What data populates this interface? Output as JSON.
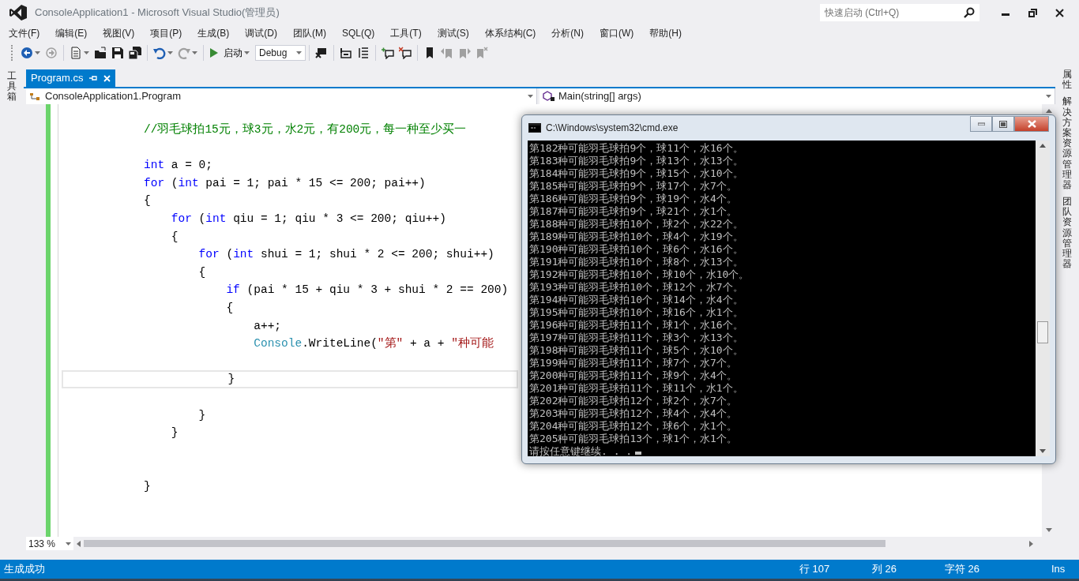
{
  "window": {
    "title": "ConsoleApplication1 - Microsoft Visual Studio(管理员)"
  },
  "quick_launch": {
    "placeholder": "快速启动 (Ctrl+Q)"
  },
  "menu": [
    {
      "label": "文件(F)"
    },
    {
      "label": "编辑(E)"
    },
    {
      "label": "视图(V)"
    },
    {
      "label": "项目(P)"
    },
    {
      "label": "生成(B)"
    },
    {
      "label": "调试(D)"
    },
    {
      "label": "团队(M)"
    },
    {
      "label": "SQL(Q)"
    },
    {
      "label": "工具(T)"
    },
    {
      "label": "测试(S)"
    },
    {
      "label": "体系结构(C)"
    },
    {
      "label": "分析(N)"
    },
    {
      "label": "窗口(W)"
    },
    {
      "label": "帮助(H)"
    }
  ],
  "toolbar": [
    {
      "kind": "back",
      "disabled": false
    },
    {
      "kind": "forward",
      "disabled": true
    },
    {
      "kind": "separator"
    },
    {
      "kind": "new",
      "disabled": false
    },
    {
      "kind": "open",
      "disabled": false
    },
    {
      "kind": "save",
      "disabled": false
    },
    {
      "kind": "save-all",
      "disabled": false
    },
    {
      "kind": "separator"
    },
    {
      "kind": "undo",
      "disabled": false
    },
    {
      "kind": "redo",
      "disabled": true
    },
    {
      "kind": "separator"
    },
    {
      "kind": "start",
      "label": "启动",
      "disabled": false
    },
    {
      "kind": "configuration",
      "value": "Debug"
    },
    {
      "kind": "separator"
    },
    {
      "kind": "attach",
      "disabled": false
    },
    {
      "kind": "separator"
    },
    {
      "kind": "outdent",
      "disabled": false
    },
    {
      "kind": "indent",
      "disabled": false
    },
    {
      "kind": "separator"
    },
    {
      "kind": "comment",
      "disabled": false
    },
    {
      "kind": "uncomment",
      "disabled": false
    },
    {
      "kind": "separator"
    },
    {
      "kind": "bookmark",
      "disabled": false
    },
    {
      "kind": "bookmark-prev",
      "disabled": true
    },
    {
      "kind": "bookmark-next",
      "disabled": true
    },
    {
      "kind": "bookmark-clear",
      "disabled": true
    }
  ],
  "left_tool_windows": [
    {
      "label": "工具箱"
    }
  ],
  "right_tool_windows": [
    {
      "label": "属性"
    },
    {
      "label": "解决方案资源管理器"
    },
    {
      "label": "团队资源管理器"
    }
  ],
  "tabs": [
    {
      "label": "Program.cs",
      "selected": true
    }
  ],
  "navigation": {
    "type": "ConsoleApplication1.Program",
    "member": "Main(string[] args)"
  },
  "code_lines": [
    {
      "kind": "code",
      "current": false,
      "tokens": [
        {
          "kind": "comment",
          "text": "//羽毛球拍15元，球3元，水2元，有200元，每一种至少买一"
        }
      ]
    },
    {
      "kind": "blank"
    },
    {
      "kind": "code",
      "current": false,
      "tokens": [
        {
          "kind": "keyword",
          "text": "int"
        },
        {
          "kind": "plain",
          "text": " a = 0;"
        }
      ]
    },
    {
      "kind": "code",
      "current": false,
      "tokens": [
        {
          "kind": "keyword",
          "text": "for"
        },
        {
          "kind": "plain",
          "text": " ("
        },
        {
          "kind": "keyword",
          "text": "int"
        },
        {
          "kind": "plain",
          "text": " pai = 1; pai * 15 <= 200; pai++)"
        }
      ]
    },
    {
      "kind": "code",
      "current": false,
      "tokens": [
        {
          "kind": "plain",
          "text": "{"
        }
      ]
    },
    {
      "kind": "code",
      "current": false,
      "tokens": [
        {
          "kind": "keyword",
          "text": "    for"
        },
        {
          "kind": "plain",
          "text": " ("
        },
        {
          "kind": "keyword",
          "text": "int"
        },
        {
          "kind": "plain",
          "text": " qiu = 1; qiu * 3 <= 200; qiu++)"
        }
      ]
    },
    {
      "kind": "code",
      "current": false,
      "tokens": [
        {
          "kind": "plain",
          "text": "    {"
        }
      ]
    },
    {
      "kind": "code",
      "current": false,
      "tokens": [
        {
          "kind": "keyword",
          "text": "        for"
        },
        {
          "kind": "plain",
          "text": " ("
        },
        {
          "kind": "keyword",
          "text": "int"
        },
        {
          "kind": "plain",
          "text": " shui = 1; shui * 2 <= 200; shui++)"
        }
      ]
    },
    {
      "kind": "code",
      "current": false,
      "tokens": [
        {
          "kind": "plain",
          "text": "        {"
        }
      ]
    },
    {
      "kind": "code",
      "current": false,
      "tokens": [
        {
          "kind": "keyword",
          "text": "            if"
        },
        {
          "kind": "plain",
          "text": " (pai * 15 + qiu * 3 + shui * 2 == 200)"
        }
      ]
    },
    {
      "kind": "code",
      "current": false,
      "tokens": [
        {
          "kind": "plain",
          "text": "            {"
        }
      ]
    },
    {
      "kind": "code",
      "current": false,
      "tokens": [
        {
          "kind": "plain",
          "text": "                a++;"
        }
      ]
    },
    {
      "kind": "code",
      "current": false,
      "tokens": [
        {
          "kind": "type",
          "text": "                Console"
        },
        {
          "kind": "plain",
          "text": ".WriteLine("
        },
        {
          "kind": "string",
          "text": "\"第\""
        },
        {
          "kind": "plain",
          "text": " + a + "
        },
        {
          "kind": "string",
          "text": "\"种可能"
        }
      ]
    },
    {
      "kind": "blank"
    },
    {
      "kind": "code",
      "current": true,
      "tokens": [
        {
          "kind": "plain",
          "text": "            }"
        }
      ]
    },
    {
      "kind": "blank"
    },
    {
      "kind": "code",
      "current": false,
      "tokens": [
        {
          "kind": "plain",
          "text": "        }"
        }
      ]
    },
    {
      "kind": "code",
      "current": false,
      "tokens": [
        {
          "kind": "plain",
          "text": "    }"
        }
      ]
    },
    {
      "kind": "blank"
    },
    {
      "kind": "blank"
    },
    {
      "kind": "code",
      "current": false,
      "tokens": [
        {
          "kind": "plain",
          "text": "}"
        }
      ]
    }
  ],
  "zoom": "133 %",
  "console": {
    "title": "C:\\Windows\\system32\\cmd.exe",
    "lines": [
      "第182种可能羽毛球拍9个，球11个，水16个。",
      "第183种可能羽毛球拍9个，球13个，水13个。",
      "第184种可能羽毛球拍9个，球15个，水10个。",
      "第185种可能羽毛球拍9个，球17个，水7个。",
      "第186种可能羽毛球拍9个，球19个，水4个。",
      "第187种可能羽毛球拍9个，球21个，水1个。",
      "第188种可能羽毛球拍10个，球2个，水22个。",
      "第189种可能羽毛球拍10个，球4个，水19个。",
      "第190种可能羽毛球拍10个，球6个，水16个。",
      "第191种可能羽毛球拍10个，球8个，水13个。",
      "第192种可能羽毛球拍10个，球10个，水10个。",
      "第193种可能羽毛球拍10个，球12个，水7个。",
      "第194种可能羽毛球拍10个，球14个，水4个。",
      "第195种可能羽毛球拍10个，球16个，水1个。",
      "第196种可能羽毛球拍11个，球1个，水16个。",
      "第197种可能羽毛球拍11个，球3个，水13个。",
      "第198种可能羽毛球拍11个，球5个，水10个。",
      "第199种可能羽毛球拍11个，球7个，水7个。",
      "第200种可能羽毛球拍11个，球9个，水4个。",
      "第201种可能羽毛球拍11个，球11个，水1个。",
      "第202种可能羽毛球拍12个，球2个，水7个。",
      "第203种可能羽毛球拍12个，球4个，水4个。",
      "第204种可能羽毛球拍12个，球6个，水1个。",
      "第205种可能羽毛球拍13个，球1个，水1个。"
    ],
    "prompt": "请按任意键继续. . ."
  },
  "status_bar": {
    "message": "生成成功",
    "line": "行 107",
    "column": "列 26",
    "char": "字符 26",
    "mode": "Ins"
  }
}
